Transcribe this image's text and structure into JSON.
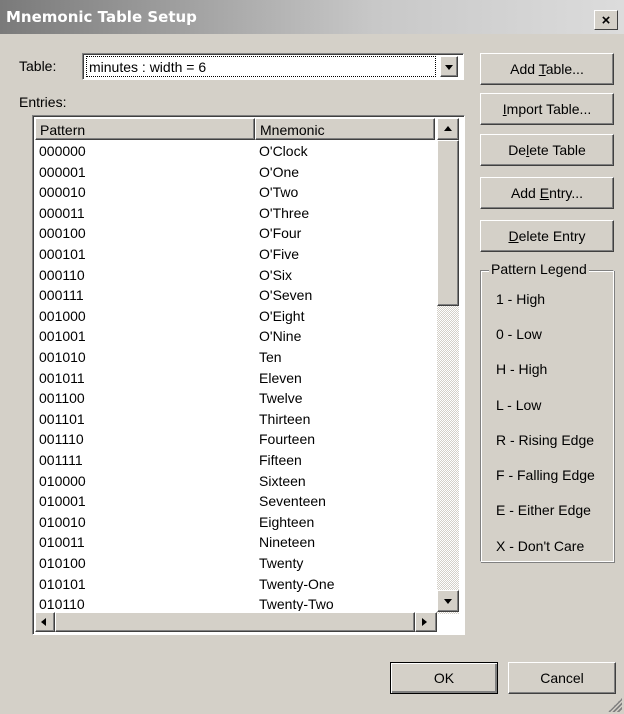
{
  "window": {
    "title": "Mnemonic Table Setup",
    "close_glyph": "×"
  },
  "table_selector": {
    "label": "Table:",
    "value": "minutes : width = 6"
  },
  "entries": {
    "label": "Entries:",
    "columns": [
      "Pattern",
      "Mnemonic"
    ],
    "rows": [
      [
        "000000",
        "O'Clock"
      ],
      [
        "000001",
        "O'One"
      ],
      [
        "000010",
        "O'Two"
      ],
      [
        "000011",
        "O'Three"
      ],
      [
        "000100",
        "O'Four"
      ],
      [
        "000101",
        "O'Five"
      ],
      [
        "000110",
        "O'Six"
      ],
      [
        "000111",
        "O'Seven"
      ],
      [
        "001000",
        "O'Eight"
      ],
      [
        "001001",
        "O'Nine"
      ],
      [
        "001010",
        "Ten"
      ],
      [
        "001011",
        "Eleven"
      ],
      [
        "001100",
        "Twelve"
      ],
      [
        "001101",
        "Thirteen"
      ],
      [
        "001110",
        "Fourteen"
      ],
      [
        "001111",
        "Fifteen"
      ],
      [
        "010000",
        "Sixteen"
      ],
      [
        "010001",
        "Seventeen"
      ],
      [
        "010010",
        "Eighteen"
      ],
      [
        "010011",
        "Nineteen"
      ],
      [
        "010100",
        "Twenty"
      ],
      [
        "010101",
        "Twenty-One"
      ],
      [
        "010110",
        "Twenty-Two"
      ]
    ]
  },
  "buttons": {
    "add_table": {
      "pre": "Add ",
      "key": "T",
      "post": "able..."
    },
    "import_table": {
      "pre": "",
      "key": "I",
      "post": "mport Table..."
    },
    "delete_table": {
      "pre": "De",
      "key": "l",
      "post": "ete Table"
    },
    "add_entry": {
      "pre": "Add ",
      "key": "E",
      "post": "ntry..."
    },
    "delete_entry": {
      "pre": "",
      "key": "D",
      "post": "elete Entry"
    },
    "ok": "OK",
    "cancel": "Cancel"
  },
  "legend": {
    "title": "Pattern Legend",
    "items": [
      "1 - High",
      "0 - Low",
      "H - High",
      "L - Low",
      "R - Rising Edge",
      "F - Falling Edge",
      "E - Either Edge",
      "X - Don't Care"
    ]
  },
  "icons": [
    "close-icon",
    "dropdown-arrow-icon",
    "scroll-up-icon",
    "scroll-down-icon",
    "scroll-left-icon",
    "scroll-right-icon",
    "resize-grip-icon"
  ]
}
